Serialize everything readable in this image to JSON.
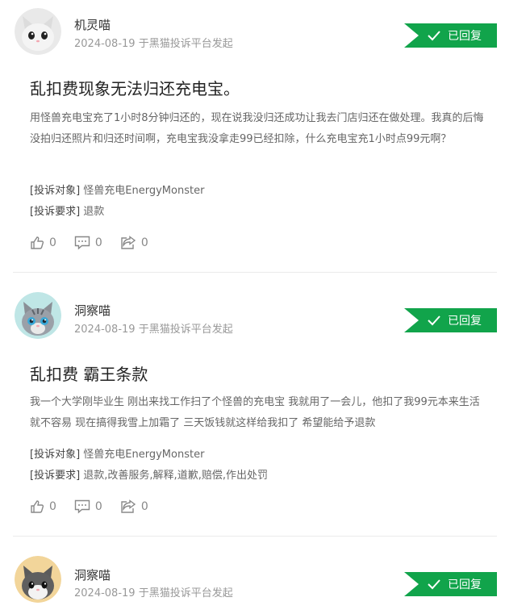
{
  "complaints": [
    {
      "user": "机灵喵",
      "date": "2024-08-19",
      "source": "于黑猫投诉平台发起",
      "status": "已回复",
      "title": "乱扣费现象无法归还充电宝。",
      "content": "用怪兽充电宝充了1小时8分钟归还的，现在说我没归还成功让我去门店归还在做处理。我真的后悔没拍归还照片和归还时间啊，充电宝我没拿走99已经扣除，什么充电宝充1小时点99元啊？",
      "target_label": "[投诉对象]",
      "target": "怪兽充电EnergyMonster",
      "request_label": "[投诉要求]",
      "request": "退款",
      "likes": "0",
      "comments": "0",
      "shares": "0"
    },
    {
      "user": "洞察喵",
      "date": "2024-08-19",
      "source": "于黑猫投诉平台发起",
      "status": "已回复",
      "title": "乱扣费 霸王条款",
      "content": "我一个大学刚毕业生 刚出来找工作扫了个怪兽的充电宝 我就用了一会儿，他扣了我99元本来生活就不容易 现在搞得我雪上加霜了 三天饭钱就这样给我扣了 希望能给予退款",
      "target_label": "[投诉对象]",
      "target": "怪兽充电EnergyMonster",
      "request_label": "[投诉要求]",
      "request": "退款,改善服务,解释,道歉,赔偿,作出处罚",
      "likes": "0",
      "comments": "0",
      "shares": "0"
    },
    {
      "user": "洞察喵",
      "date": "2024-08-19",
      "source": "于黑猫投诉平台发起",
      "status": "已回复"
    }
  ],
  "colors": {
    "accent": "#11a44b"
  },
  "icons": [
    "thumbs-up-icon",
    "comment-icon",
    "share-icon",
    "check-icon"
  ]
}
